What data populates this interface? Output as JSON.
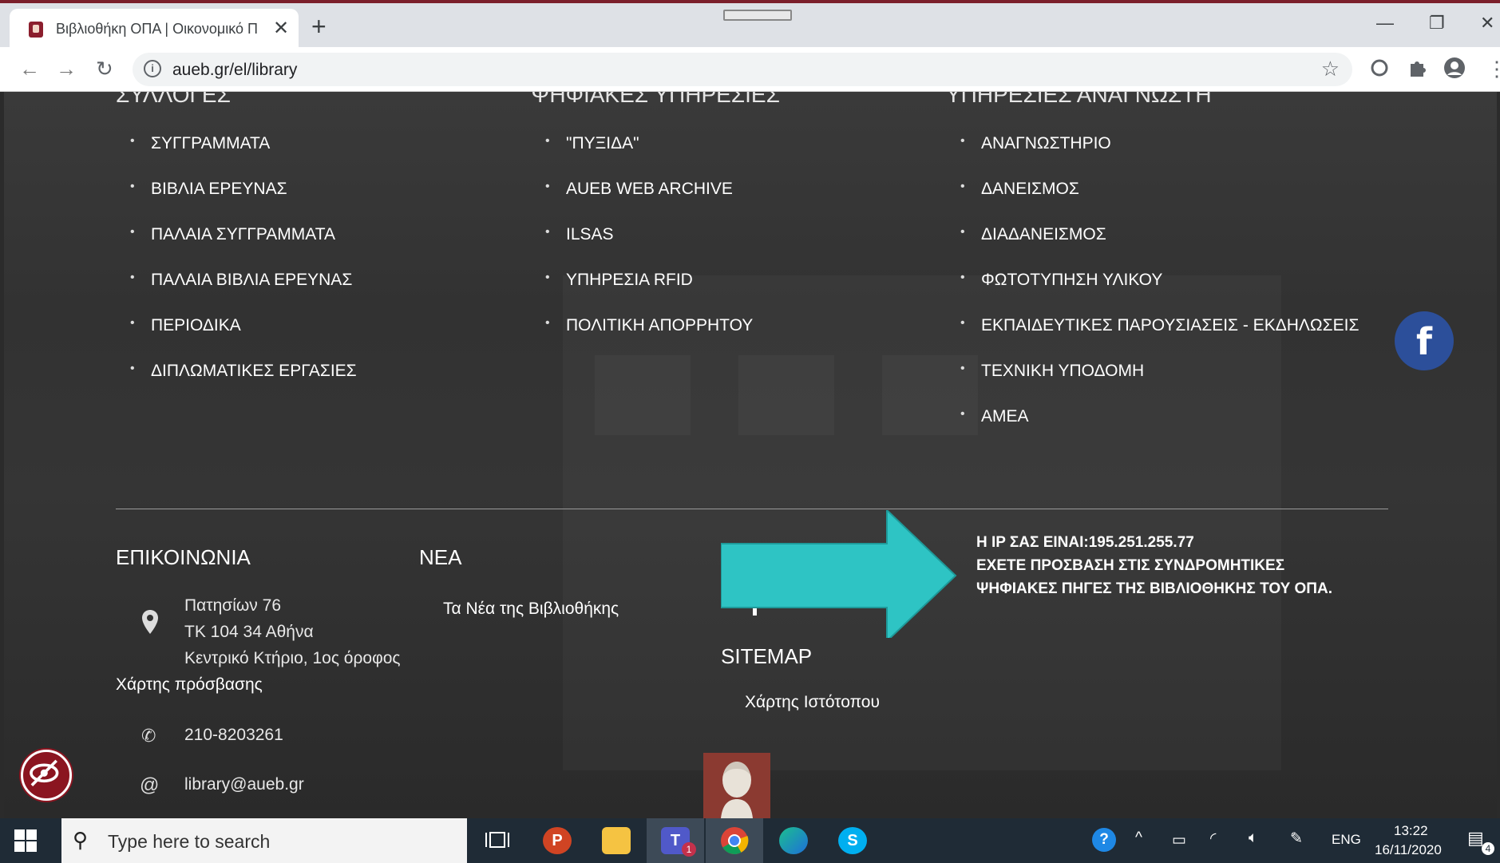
{
  "browser": {
    "tab_title": "Βιβλιοθήκη ΟΠΑ | Οικονομικό Π",
    "tab_close": "✕",
    "new_tab": "+",
    "url": "aueb.gr/el/library"
  },
  "page": {
    "collections": {
      "title": "ΣΥΛΛΟΓΕΣ",
      "items": [
        "ΣΥΓΓΡΑΜΜΑΤΑ",
        "ΒΙΒΛΙΑ ΕΡΕΥΝΑΣ",
        "ΠΑΛΑΙΑ ΣΥΓΓΡΑΜΜΑΤΑ",
        "ΠΑΛΑΙΑ ΒΙΒΛΙΑ ΕΡΕΥΝΑΣ",
        "ΠΕΡΙΟΔΙΚΑ",
        "ΔΙΠΛΩΜΑΤΙΚΕΣ ΕΡΓΑΣΙΕΣ"
      ]
    },
    "digital_services": {
      "title": "ΨΗΦΙΑΚΕΣ ΥΠΗΡΕΣΙΕΣ",
      "items": [
        "\"ΠΥΞΙΔΑ\"",
        "AUEB WEB ARCHIVE",
        "ILSAS",
        "ΥΠΗΡΕΣΙΑ RFID",
        "ΠΟΛΙΤΙΚΗ ΑΠΟΡΡΗΤΟΥ"
      ]
    },
    "reader_services": {
      "title": "ΥΠΗΡΕΣΙΕΣ ΑΝΑΓΝΩΣΤΗ",
      "items": [
        "ΑΝΑΓΝΩΣΤΗΡΙΟ",
        "ΔΑΝΕΙΣΜΟΣ",
        "ΔΙΑΔΑΝΕΙΣΜΟΣ",
        "ΦΩΤΟΤΥΠΗΣΗ ΥΛΙΚΟΥ",
        "ΕΚΠΑΙΔΕΥΤΙΚΕΣ ΠΑΡΟΥΣΙΑΣΕΙΣ - ΕΚΔΗΛΩΣΕΙΣ",
        "ΤΕΧΝΙΚΗ ΥΠΟΔΟΜΗ",
        "ΑΜΕΑ"
      ]
    },
    "contact": {
      "heading": "ΕΠΙΚΟΙΝΩΝΙΑ",
      "address_line1": "Πατησίων 76",
      "address_line2": "ΤΚ 104 34 Αθήνα",
      "address_line3": "Κεντρικό Κτήριο, 1ος όροφος",
      "map_link": "Χάρτης πρόσβασης",
      "phone": "210-8203261",
      "email": "library@aueb.gr"
    },
    "news": {
      "heading": "ΝΕΑ",
      "link": "Τα Νέα της Βιβλιοθήκης"
    },
    "sitemap": {
      "heading": "SITEMAP",
      "link": "Χάρτης Ιστότοπου"
    },
    "ip_notice": {
      "line1": "Η IP ΣΑΣ ΕΙΝΑΙ:195.251.255.77",
      "line2": "ΕΧΕΤΕ ΠΡΟΣΒΑΣΗ ΣΤΙΣ ΣΥΝΔΡΟΜΗΤΙΚΕΣ ΨΗΦΙΑΚΕΣ ΠΗΓΕΣ ΤΗΣ ΒΙΒΛΙΟΘΗΚΗΣ ΤΟΥ ΟΠΑ."
    },
    "facebook_label": "f"
  },
  "taskbar": {
    "search_placeholder": "Type here to search",
    "language": "ENG",
    "time": "13:22",
    "date": "16/11/2020",
    "notification_count": "4",
    "teams_badge": "1"
  },
  "colors": {
    "arrow": "#2ec4c4",
    "facebook": "#2c4f9a",
    "accessibility": "#8b1520",
    "taskbar": "#1f2b36"
  }
}
